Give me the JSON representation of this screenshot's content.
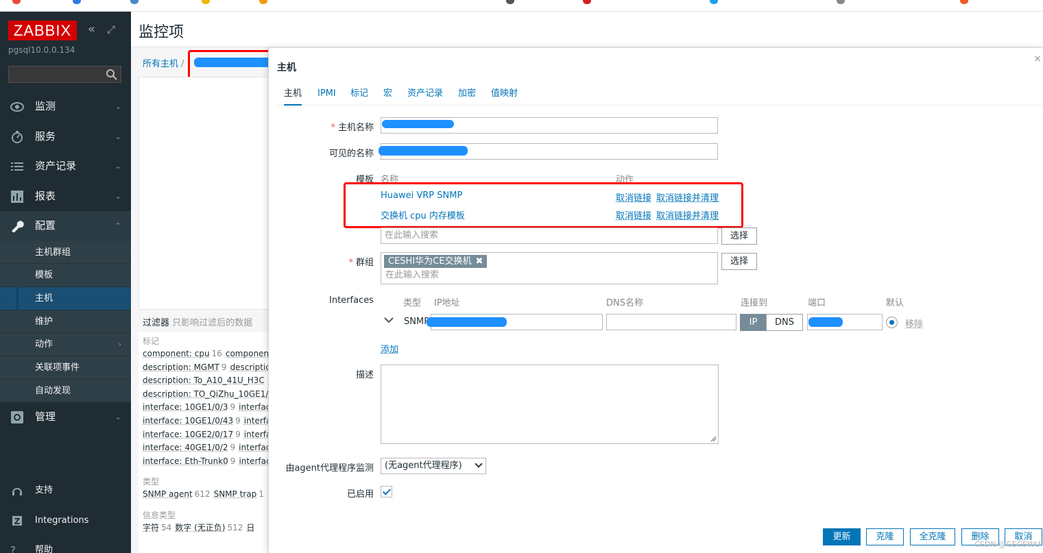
{
  "app": {
    "logo": "ZABBIX",
    "server": "pgsql10.0.0.134",
    "page_title": "监控项"
  },
  "breadcrumb": {
    "all_hosts": "所有主机",
    "sep": "/"
  },
  "sidebar": {
    "search_placeholder": "",
    "menu": [
      {
        "label": "监测",
        "icon": "eye-icon"
      },
      {
        "label": "服务",
        "icon": "clock-icon"
      },
      {
        "label": "资产记录",
        "icon": "list-icon"
      },
      {
        "label": "报表",
        "icon": "bar-chart-icon"
      },
      {
        "label": "配置",
        "icon": "wrench-icon"
      }
    ],
    "config_sub": [
      "主机群组",
      "模板",
      "主机",
      "维护",
      "动作",
      "关联项事件",
      "自动发现"
    ],
    "admin": {
      "label": "管理",
      "icon": "gear-icon"
    },
    "support": "支持",
    "integrations": "Integrations",
    "help": "帮助"
  },
  "background": {
    "filter_title": "过滤器",
    "filter_sub": "只影响过滤后的数据",
    "tags_heading": "标记",
    "tags": [
      {
        "tag": "component: cpu",
        "count": "16",
        "next": "componen"
      },
      {
        "tag": "description: MGMT",
        "count": "9",
        "next": "descriptio"
      },
      {
        "tag": "description: To_A10_41U_H3C",
        "count": "",
        "next": ""
      },
      {
        "tag": "description: TO_QiZhu_10GE1/",
        "count": "",
        "next": ""
      },
      {
        "tag": "interface: 10GE1/0/3",
        "count": "9",
        "next": "interfac"
      },
      {
        "tag": "interface: 10GE1/0/43",
        "count": "9",
        "next": "interfa"
      },
      {
        "tag": "interface: 10GE2/0/17",
        "count": "9",
        "next": "interfa"
      },
      {
        "tag": "interface: 40GE1/0/2",
        "count": "9",
        "next": "interfac"
      },
      {
        "tag": "interface: Eth-Trunk0",
        "count": "9",
        "next": "interfac"
      }
    ],
    "type_heading": "类型",
    "types": [
      {
        "tag": "SNMP agent",
        "count": "612",
        "next": "SNMP trap",
        "next_count": "1"
      }
    ],
    "info_heading": "信息类型",
    "infos": [
      {
        "tag": "字符",
        "count": "54",
        "next": "数字 (无正负)",
        "next_count": "512",
        "more": "日"
      }
    ]
  },
  "modal": {
    "title": "主机",
    "close": "×",
    "tabs": [
      "主机",
      "IPMI",
      "标记",
      "宏",
      "资产记录",
      "加密",
      "值映射"
    ],
    "host_name_label": "主机名称",
    "visible_name_label": "可见的名称",
    "templates_label": "模板",
    "templates_col_name": "名称",
    "templates_col_action": "动作",
    "templates": [
      {
        "name": "Huawei VRP SNMP",
        "unlink": "取消链接",
        "unlink_clear": "取消链接并清理"
      },
      {
        "name": "交换机 cpu 内存模板",
        "unlink": "取消链接",
        "unlink_clear": "取消链接并清理"
      }
    ],
    "template_search_placeholder": "在此输入搜索",
    "select_button": "选择",
    "groups_label": "群组",
    "group_chip": "CESHI华为CE交换机",
    "group_chip_remove": "✖",
    "group_search_placeholder": "在此输入搜索",
    "interfaces_label": "Interfaces",
    "iface_cols": {
      "type": "类型",
      "ip": "IP地址",
      "dns": "DNS名称",
      "connect": "连接到",
      "port": "端口",
      "default": "默认"
    },
    "iface_row": {
      "type": "SNMP",
      "ip": "",
      "dns": "",
      "connect_ip": "IP",
      "connect_dns": "DNS",
      "port": "",
      "remove": "移除"
    },
    "add_link": "添加",
    "description_label": "描述",
    "proxy_label": "由agent代理程序监测",
    "proxy_value": "(无agent代理程序)",
    "enabled_label": "已启用",
    "buttons": {
      "update": "更新",
      "clone": "克隆",
      "full_clone": "全克隆",
      "delete": "删除",
      "cancel": "取消"
    }
  },
  "watermark": "CSDN @GEGEWU"
}
